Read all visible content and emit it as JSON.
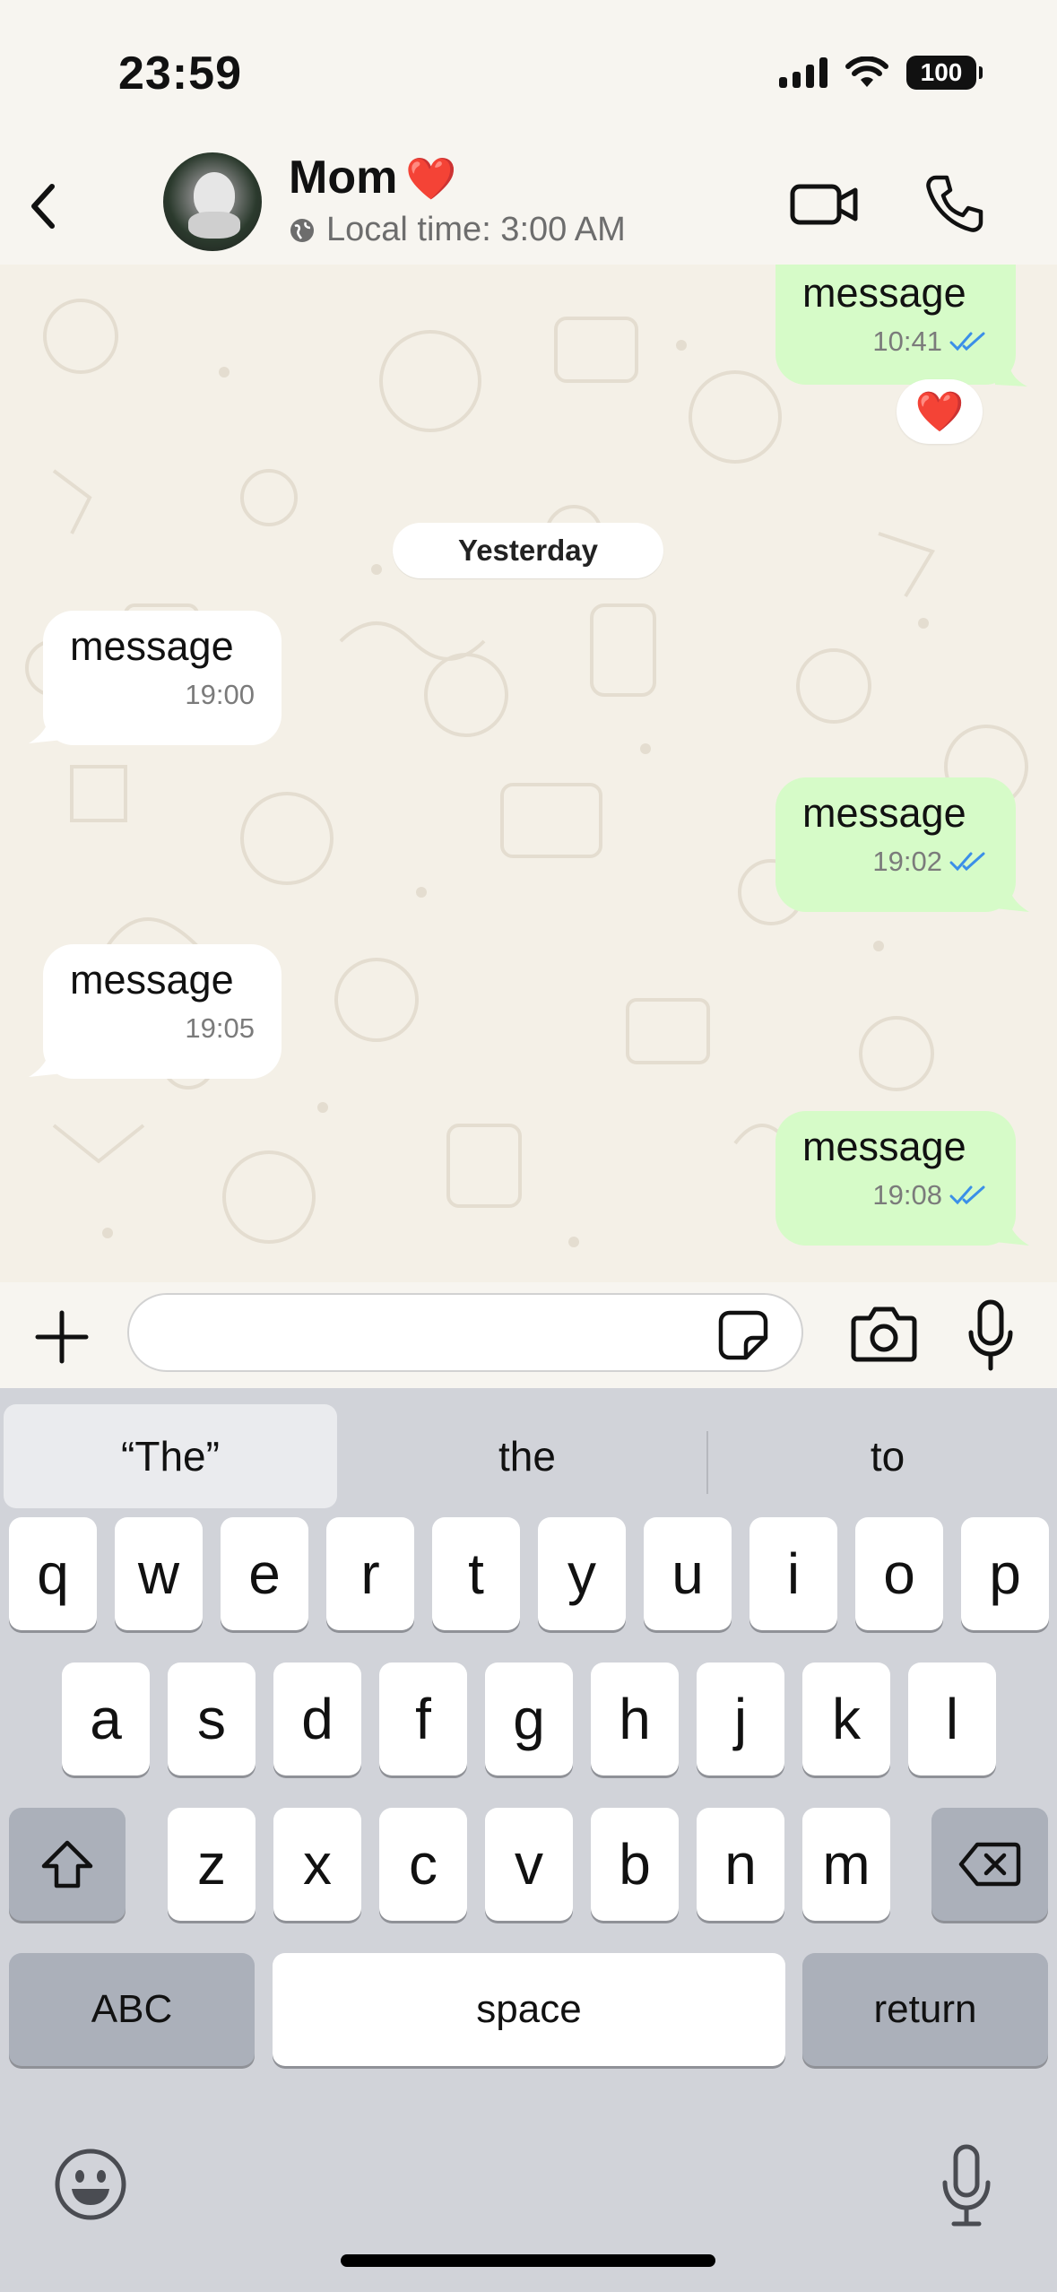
{
  "status_bar": {
    "time": "23:59",
    "battery": "100"
  },
  "header": {
    "back_icon": "chevron-left-icon",
    "contact_name": "Mom",
    "contact_emoji": "❤️",
    "subtitle": "Local time: 3:00 AM",
    "globe_icon": "globe-icon",
    "video_icon": "video-camera-icon",
    "call_icon": "phone-icon"
  },
  "chat": {
    "date_separator": "Yesterday",
    "reaction": "❤️",
    "messages": [
      {
        "direction": "out",
        "text": "message",
        "time": "10:41",
        "status": "read"
      },
      {
        "direction": "in",
        "text": "message",
        "time": "19:00"
      },
      {
        "direction": "out",
        "text": "message",
        "time": "19:02",
        "status": "read"
      },
      {
        "direction": "in",
        "text": "message",
        "time": "19:05"
      },
      {
        "direction": "out",
        "text": "message",
        "time": "19:08",
        "status": "read"
      }
    ]
  },
  "input_bar": {
    "placeholder": "",
    "value": ""
  },
  "keyboard": {
    "suggestions": [
      "“The”",
      "the",
      "to"
    ],
    "row1": [
      "q",
      "w",
      "e",
      "r",
      "t",
      "y",
      "u",
      "i",
      "o",
      "p"
    ],
    "row2": [
      "a",
      "s",
      "d",
      "f",
      "g",
      "h",
      "j",
      "k",
      "l"
    ],
    "row3": [
      "z",
      "x",
      "c",
      "v",
      "b",
      "n",
      "m"
    ],
    "abc_label": "ABC",
    "space_label": "space",
    "return_label": "return"
  },
  "colors": {
    "outgoing_bubble": "#d6fbc8",
    "incoming_bubble": "#ffffff",
    "read_ticks": "#3b8fe8",
    "heart": "#e0242b"
  }
}
